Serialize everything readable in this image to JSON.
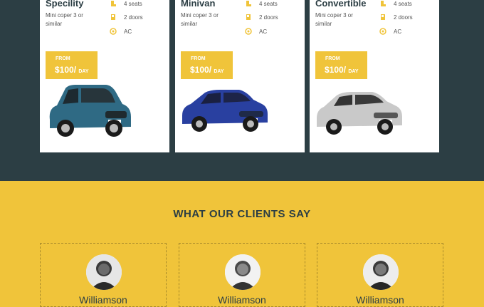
{
  "cars": [
    {
      "title": "Specility",
      "description": "Mini coper 3 or similar",
      "seats": "4 seats",
      "doors": "2 doors",
      "ac": "AC",
      "price_from": "FROM",
      "price": "$100/",
      "per": "DAY",
      "body_color": "#2f6a84"
    },
    {
      "title": "Minivan",
      "description": "Mini coper 3 or similar",
      "seats": "4 seats",
      "doors": "2 doors",
      "ac": "AC",
      "price_from": "FROM",
      "price": "$100/",
      "per": "DAY",
      "body_color": "#2940a0"
    },
    {
      "title": "Convertible",
      "description": "Mini coper 3 or similar",
      "seats": "4 seats",
      "doors": "2 doors",
      "ac": "AC",
      "price_from": "FROM",
      "price": "$100/",
      "per": "DAY",
      "body_color": "#c9c9c9"
    }
  ],
  "testimonials": {
    "heading": "WHAT OUR CLIENTS SAY",
    "clients": [
      {
        "name": "Williamson"
      },
      {
        "name": "Williamson"
      },
      {
        "name": "Williamson"
      }
    ]
  },
  "colors": {
    "accent": "#f0c43a",
    "dark": "#2c3e44"
  },
  "icons": {
    "seats": "seat-icon",
    "doors": "door-icon",
    "ac": "snowflake-icon"
  }
}
